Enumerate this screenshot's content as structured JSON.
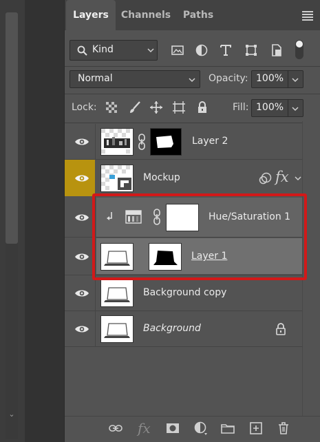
{
  "tabs": {
    "layers": "Layers",
    "channels": "Channels",
    "paths": "Paths"
  },
  "filter": {
    "kind": "Kind"
  },
  "blend": {
    "mode": "Normal",
    "opacity_label": "Opacity:",
    "opacity_value": "100%"
  },
  "lock": {
    "label": "Lock:",
    "fill_label": "Fill:",
    "fill_value": "100%"
  },
  "layers": [
    {
      "name": "Layer 2"
    },
    {
      "name": "Mockup"
    },
    {
      "name": "Hue/Saturation 1"
    },
    {
      "name": "Layer 1"
    },
    {
      "name": "Background copy"
    },
    {
      "name": "Background"
    }
  ],
  "colors": {
    "panel": "#535353",
    "selected_eye_bg": "#b8930f",
    "highlight_box": "#d21919",
    "group_bg": "#646464"
  },
  "icons": {
    "layer_style_fx": "fx",
    "bottom_fx": "fx"
  }
}
